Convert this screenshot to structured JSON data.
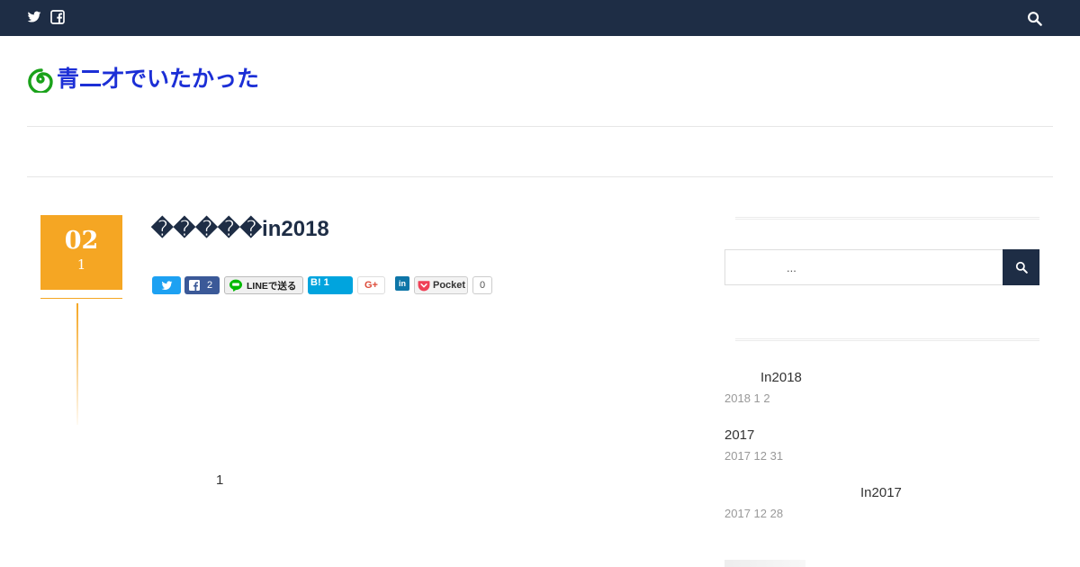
{
  "site": {
    "title": "青二才でいたかった"
  },
  "topbar": {
    "icons": [
      "twitter-icon",
      "facebook-icon",
      "search-icon"
    ],
    "bg_color": "#1e2d45"
  },
  "post": {
    "date_day": "02",
    "date_month": "1",
    "title": "�����in2018",
    "page_number": "1",
    "accent_color": "#f5a623"
  },
  "share": {
    "facebook_count": "2",
    "line_label": "LINEで送る",
    "hatena_label": "B! 1",
    "gplus_label": "G+",
    "linkedin_label": "in",
    "pocket_label": "Pocket",
    "pocket_count": "0"
  },
  "sidebar": {
    "search": {
      "placeholder": "..."
    },
    "recent_posts": [
      {
        "title": "In2018",
        "date": "2018  1  2"
      },
      {
        "title": "2017",
        "date": "2017  12  31"
      },
      {
        "title": "In2017",
        "date": "2017  12  28"
      }
    ]
  }
}
